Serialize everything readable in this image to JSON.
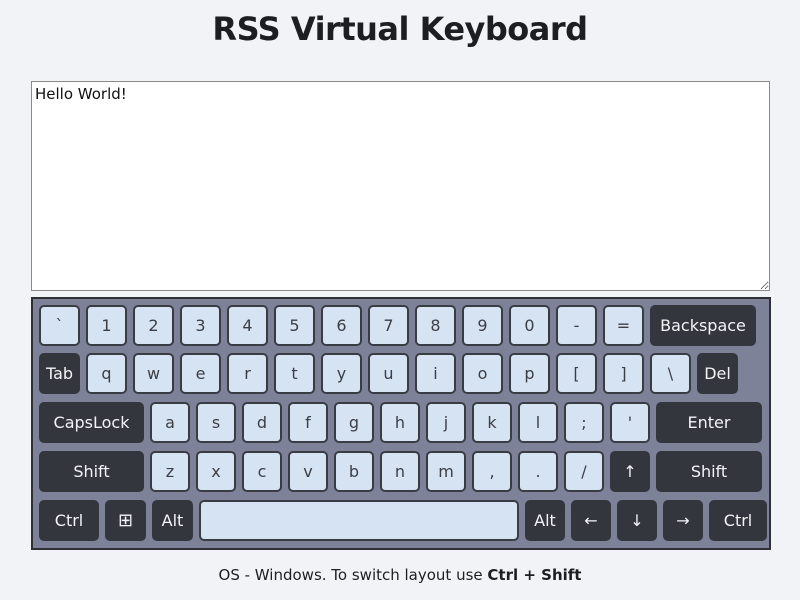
{
  "title": "RSS Virtual Keyboard",
  "textarea": {
    "value": "Hello World!"
  },
  "keyboard": {
    "row1": [
      "`",
      "1",
      "2",
      "3",
      "4",
      "5",
      "6",
      "7",
      "8",
      "9",
      "0",
      "-",
      "=",
      "Backspace"
    ],
    "row2": [
      "Tab",
      "q",
      "w",
      "e",
      "r",
      "t",
      "y",
      "u",
      "i",
      "o",
      "p",
      "[",
      "]",
      "\\",
      "Del"
    ],
    "row3": [
      "CapsLock",
      "a",
      "s",
      "d",
      "f",
      "g",
      "h",
      "j",
      "k",
      "l",
      ";",
      "'",
      "Enter"
    ],
    "row4": [
      "Shift",
      "z",
      "x",
      "c",
      "v",
      "b",
      "n",
      "m",
      ",",
      ".",
      "/",
      "↑",
      "Shift"
    ],
    "row5": [
      "Ctrl",
      "⊞",
      "Alt",
      "",
      "Alt",
      "←",
      "↓",
      "→",
      "Ctrl"
    ],
    "win_icon": "windows-icon"
  },
  "hint": {
    "prefix": "OS - Windows. To switch layout use ",
    "combo": "Ctrl + Shift"
  },
  "colors": {
    "background": "#f2f3f7",
    "keyboard_bg": "#7d8299",
    "key_light": "#d6e3f3",
    "key_dark": "#34363e"
  }
}
